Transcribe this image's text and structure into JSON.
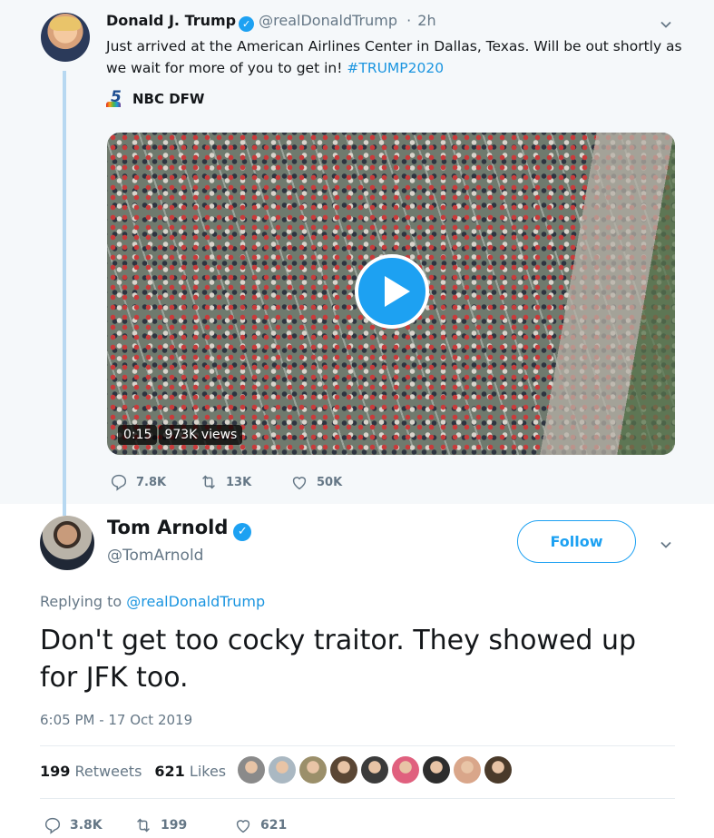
{
  "parent_tweet": {
    "author_name": "Donald J. Trump",
    "handle": "@realDonaldTrump",
    "separator": "·",
    "time": "2h",
    "text": "Just arrived at the American Airlines Center in Dallas, Texas. Will be out shortly as we wait for more of you to get in! ",
    "hashtag": "#TRUMP2020",
    "media_source": "NBC DFW",
    "video": {
      "duration": "0:15",
      "views": "973K views"
    },
    "counts": {
      "replies": "7.8K",
      "retweets": "13K",
      "likes": "50K"
    }
  },
  "main_tweet": {
    "author_name": "Tom Arnold",
    "handle": "@TomArnold",
    "follow_label": "Follow",
    "replying_prefix": "Replying to ",
    "replying_to": "@realDonaldTrump",
    "text": "Don't get too cocky traitor. They showed up for JFK too.",
    "timestamp": "6:05 PM - 17 Oct 2019",
    "retweets_count": "199",
    "retweets_label": "Retweets",
    "likes_count": "621",
    "likes_label": "Likes",
    "counts": {
      "replies": "3.8K",
      "retweets": "199",
      "likes": "621"
    }
  },
  "colors": {
    "accent": "#1da1f2",
    "link": "#1b95e0",
    "muted": "#657786",
    "thread_line": "#b7d8f1",
    "parent_bg": "#f5f8fa"
  },
  "likers": [
    {
      "color": "#8a8a8a"
    },
    {
      "color": "#aab8c2"
    },
    {
      "color": "#9b8f6a"
    },
    {
      "color": "#5a4634"
    },
    {
      "color": "#3b3b3b"
    },
    {
      "color": "#e0607e"
    },
    {
      "color": "#2d2d2d"
    },
    {
      "color": "#d9a68a"
    },
    {
      "color": "#4a3a2a"
    }
  ]
}
